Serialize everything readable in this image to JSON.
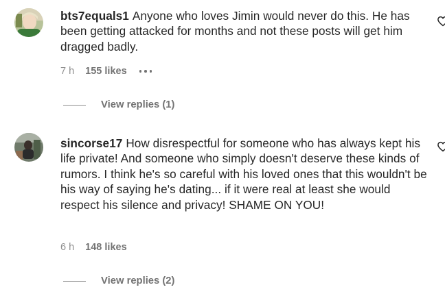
{
  "comments": [
    {
      "username": "bts7equals1",
      "text": "Anyone who loves Jimin would never do this. He has been getting attacked for months and not these posts will get him dragged badly.",
      "time": "7 h",
      "likes": "155 likes",
      "view_replies": "View replies (1)",
      "avatar_icon": "user-avatar",
      "like_icon": "heart-outline-icon",
      "more_icon": "more-options-icon"
    },
    {
      "username": "sincorse17",
      "text": "How disrespectful for someone who has always kept his life private! And someone who simply doesn't deserve these kinds of rumors. I think he's so careful with his loved ones that this wouldn't be his way of saying he's dating... if it were real at least she would respect his silence and privacy! SHAME ON YOU!",
      "time": "6 h",
      "likes": "148 likes",
      "view_replies": "View replies (2)",
      "avatar_icon": "user-avatar",
      "like_icon": "heart-outline-icon"
    }
  ],
  "colors": {
    "text": "#262626",
    "secondary": "#8e8e8e",
    "background": "#ffffff"
  }
}
